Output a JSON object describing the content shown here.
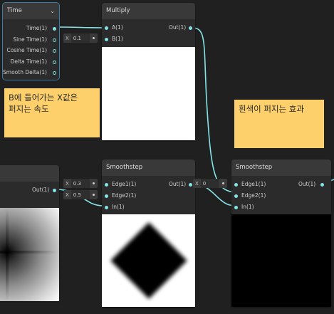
{
  "nodes": {
    "time": {
      "title": "Time",
      "outputs": [
        "Time(1)",
        "Sine Time(1)",
        "Cosine Time(1)",
        "Delta Time(1)",
        "Smooth Delta(1)"
      ]
    },
    "multiply": {
      "title": "Multiply",
      "inputs": [
        "A(1)",
        "B(1)"
      ],
      "output": "Out(1)",
      "b_field": {
        "axis": "X",
        "value": "0.1"
      }
    },
    "smoothstep1": {
      "title": "Smoothstep",
      "inputs": [
        "Edge1(1)",
        "Edge2(1)",
        "In(1)"
      ],
      "output": "Out(1)",
      "edge1_field": {
        "axis": "X",
        "value": "0.3"
      },
      "edge2_field": {
        "axis": "X",
        "value": "0.5"
      }
    },
    "smoothstep2": {
      "title": "Smoothstep",
      "inputs": [
        "Edge1(1)",
        "Edge2(1)",
        "In(1)"
      ],
      "output": "Out(1)",
      "edge1_field": {
        "axis": "X",
        "value": "0"
      }
    },
    "left_node": {
      "output": "Out(1)"
    }
  },
  "notes": {
    "note1": "B에 들어가는 X값은\n퍼지는 속도",
    "note2": "흰색이 퍼지는 효과"
  },
  "colors": {
    "canvas": "#202020",
    "node_body": "#2b2b2b",
    "node_header": "#393939",
    "wire": "#84e4e7",
    "note": "#fdd06b",
    "selection": "#3b7fa8"
  },
  "icons": {
    "time_header": "chevron-down-icon"
  }
}
